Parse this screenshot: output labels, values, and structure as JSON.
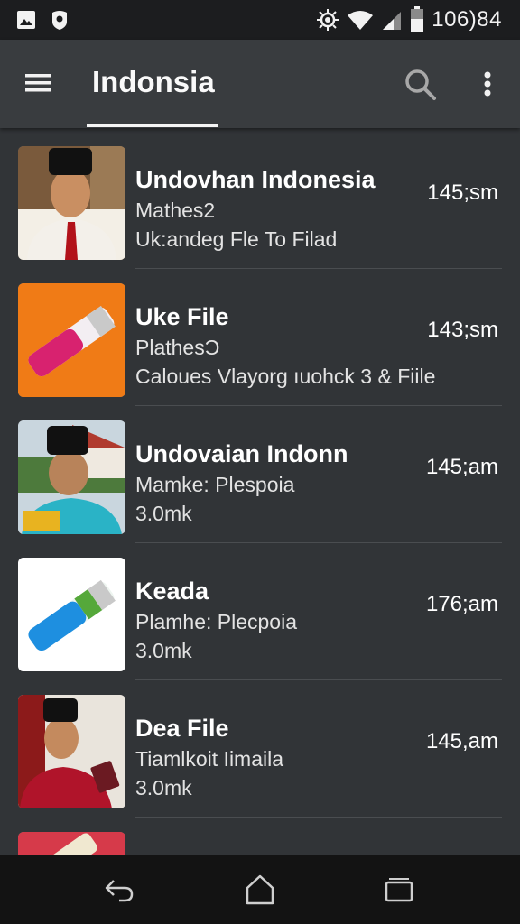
{
  "status_bar": {
    "time": "106)84",
    "icons": [
      "image-icon",
      "shield-icon",
      "bug-icon",
      "wifi-icon",
      "signal-icon",
      "battery-icon"
    ]
  },
  "app_bar": {
    "title": "Indonsia",
    "icons": [
      "menu-icon",
      "search-icon",
      "more-vert-icon"
    ]
  },
  "items": [
    {
      "title": "Undovhan Indonesia",
      "subtitle": "Mathes2",
      "meta": "Uk:andeg Fle To Filad",
      "time": "145;sm",
      "thumb": "man-portrait"
    },
    {
      "title": "Uke File",
      "subtitle": "PlathesƆ",
      "meta": "Caloues Vlayorg ıuohck 3 & Fiile",
      "time": "143;sm",
      "thumb": "pink-tube"
    },
    {
      "title": "Undovaian Indonn",
      "subtitle": "Mamke: Plespoia",
      "meta": "3.0mk",
      "time": "145;am",
      "thumb": "man-outdoor"
    },
    {
      "title": "Keada",
      "subtitle": "Plamhe: Plecpoia",
      "meta": "3.0mk",
      "time": "176;am",
      "thumb": "blue-tube"
    },
    {
      "title": "Dea File",
      "subtitle": "Tiamlkoit Iimaila",
      "meta": "3.0mk",
      "time": "145,am",
      "thumb": "man-red-shirt"
    },
    {
      "title": "",
      "subtitle": "",
      "meta": "",
      "time": "",
      "thumb": "red-partial"
    }
  ],
  "nav_bar": {
    "icons": [
      "back-icon",
      "home-icon",
      "recents-icon"
    ]
  },
  "colors": {
    "status_bar": "#1c1d1f",
    "app_bar": "#393c3f",
    "list_bg": "#313437",
    "nav_bar": "#131313"
  }
}
